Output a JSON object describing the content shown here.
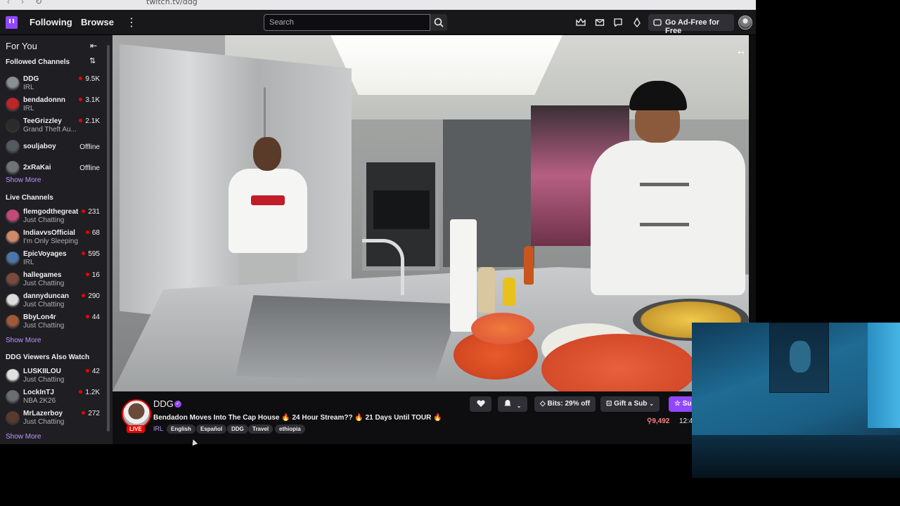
{
  "browser": {
    "url": "twitch.tv/ddg"
  },
  "topnav": {
    "following": "Following",
    "browse": "Browse",
    "more": "⋮",
    "search_placeholder": "Search",
    "go_ad_free": "Go Ad-Free for Free"
  },
  "sidebar": {
    "title": "For You",
    "followed_label": "Followed Channels",
    "followed": [
      {
        "name": "DDG",
        "game": "IRL",
        "viewers": "9.5K",
        "color": "#8a8f96"
      },
      {
        "name": "bendadonnn",
        "game": "IRL",
        "viewers": "3.1K",
        "color": "#c0242b"
      },
      {
        "name": "TeeGrizzley",
        "game": "Grand Theft Au...",
        "viewers": "2.1K",
        "color": "#2b2b2b"
      },
      {
        "name": "souljaboy",
        "status": "Offline",
        "color": "#555a60"
      },
      {
        "name": "2xRaKai",
        "status": "Offline",
        "color": "#707478"
      }
    ],
    "show_more_1": "Show More",
    "live_label": "Live Channels",
    "live": [
      {
        "name": "flemgodthegreat",
        "game": "Just Chatting",
        "viewers": "231",
        "color": "#c24a7a"
      },
      {
        "name": "IndiavvsOfficial",
        "game": "I'm Only Sleeping",
        "viewers": "68",
        "color": "#d08a6a"
      },
      {
        "name": "EpicVoyages",
        "game": "IRL",
        "viewers": "595",
        "color": "#4a76a8"
      },
      {
        "name": "hallegames",
        "game": "Just Chatting",
        "viewers": "16",
        "color": "#7a4a3a"
      },
      {
        "name": "dannyduncan",
        "game": "Just Chatting",
        "viewers": "290",
        "color": "#dcdcdc"
      },
      {
        "name": "BbyLon4r",
        "game": "Just Chatting",
        "viewers": "44",
        "color": "#a05a3a"
      }
    ],
    "show_more_2": "Show More",
    "also_label": "DDG Viewers Also Watch",
    "also": [
      {
        "name": "LUSKIILOU",
        "game": "Just Chatting",
        "viewers": "42",
        "color": "#e0e0e0"
      },
      {
        "name": "LockInTJ",
        "game": "NBA 2K26",
        "viewers": "1.2K",
        "color": "#6a6e72"
      },
      {
        "name": "MrLazerboy",
        "game": "Just Chatting",
        "viewers": "272",
        "color": "#5a3a2e"
      }
    ],
    "show_more_3": "Show More"
  },
  "stream": {
    "channel": "DDG",
    "live": "LIVE",
    "title": "Bendadon Moves Into The Cap House 🔥 24 Hour Stream?? 🔥 21 Days Until TOUR 🔥",
    "category": "IRL",
    "tags": [
      "English",
      "Español",
      "DDG",
      "Travel",
      "ethiopia"
    ],
    "bits_label": "Bits: 29% off",
    "gift_label": "Gift a Sub",
    "subscribe_label": "Subscribe",
    "viewers": "9,492",
    "uptime": "12:4"
  },
  "colors": {
    "accent": "#9147ff",
    "live": "#eb0400",
    "link": "#bf94ff"
  }
}
